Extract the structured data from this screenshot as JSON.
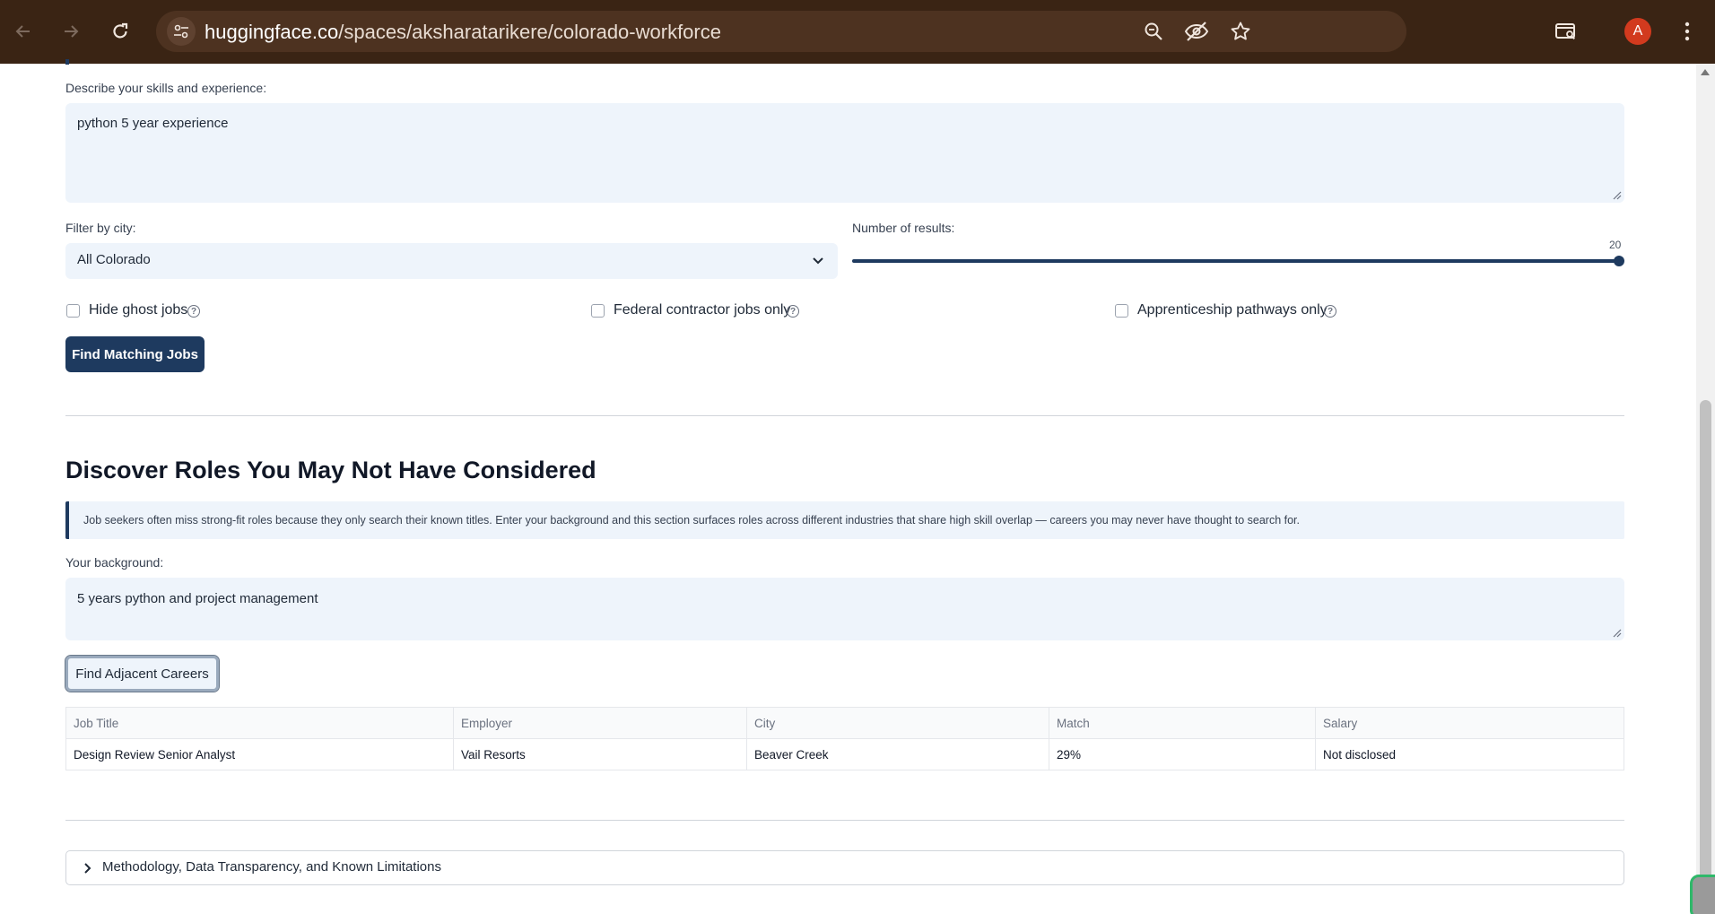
{
  "browser": {
    "url_host": "huggingface.co",
    "url_path": "/spaces/aksharatarikere/colorado-workforce",
    "profile_initial": "A",
    "icons": [
      "back-icon",
      "forward-icon",
      "reload-icon",
      "site-settings-icon",
      "zoom-icon",
      "eye-off-icon",
      "star-icon",
      "tab-search-icon",
      "more-icon"
    ]
  },
  "job_search": {
    "skills_label": "Describe your skills and experience:",
    "skills_value": "python 5 year experience",
    "city_label": "Filter by city:",
    "city_value": "All Colorado",
    "results_label": "Number of results:",
    "results_value": "20",
    "results_fraction": 1.0,
    "checkboxes": [
      {
        "label": "Hide ghost jobs",
        "checked": false
      },
      {
        "label": "Federal contractor jobs only",
        "checked": false
      },
      {
        "label": "Apprenticeship pathways only",
        "checked": false
      }
    ],
    "submit_label": "Find Matching Jobs"
  },
  "adjacent": {
    "heading": "Discover Roles You May Not Have Considered",
    "callout": "Job seekers often miss strong-fit roles because they only search their known titles. Enter your background and this section surfaces roles across different industries that share high skill overlap — careers you may never have thought to search for.",
    "background_label": "Your background:",
    "background_value": "5 years python and project management",
    "button_label": "Find Adjacent Careers",
    "table": {
      "headers": [
        "Job Title",
        "Employer",
        "City",
        "Match",
        "Salary"
      ],
      "rows": [
        [
          "Design Review Senior Analyst",
          "Vail Resorts",
          "Beaver Creek",
          "29%",
          "Not disclosed"
        ]
      ]
    }
  },
  "methodology": {
    "label": "Methodology, Data Transparency, and Known Limitations"
  },
  "colors": {
    "primary": "#1e3a5f",
    "input_bg": "#eef4fb",
    "chrome_bg": "#3a2414"
  }
}
